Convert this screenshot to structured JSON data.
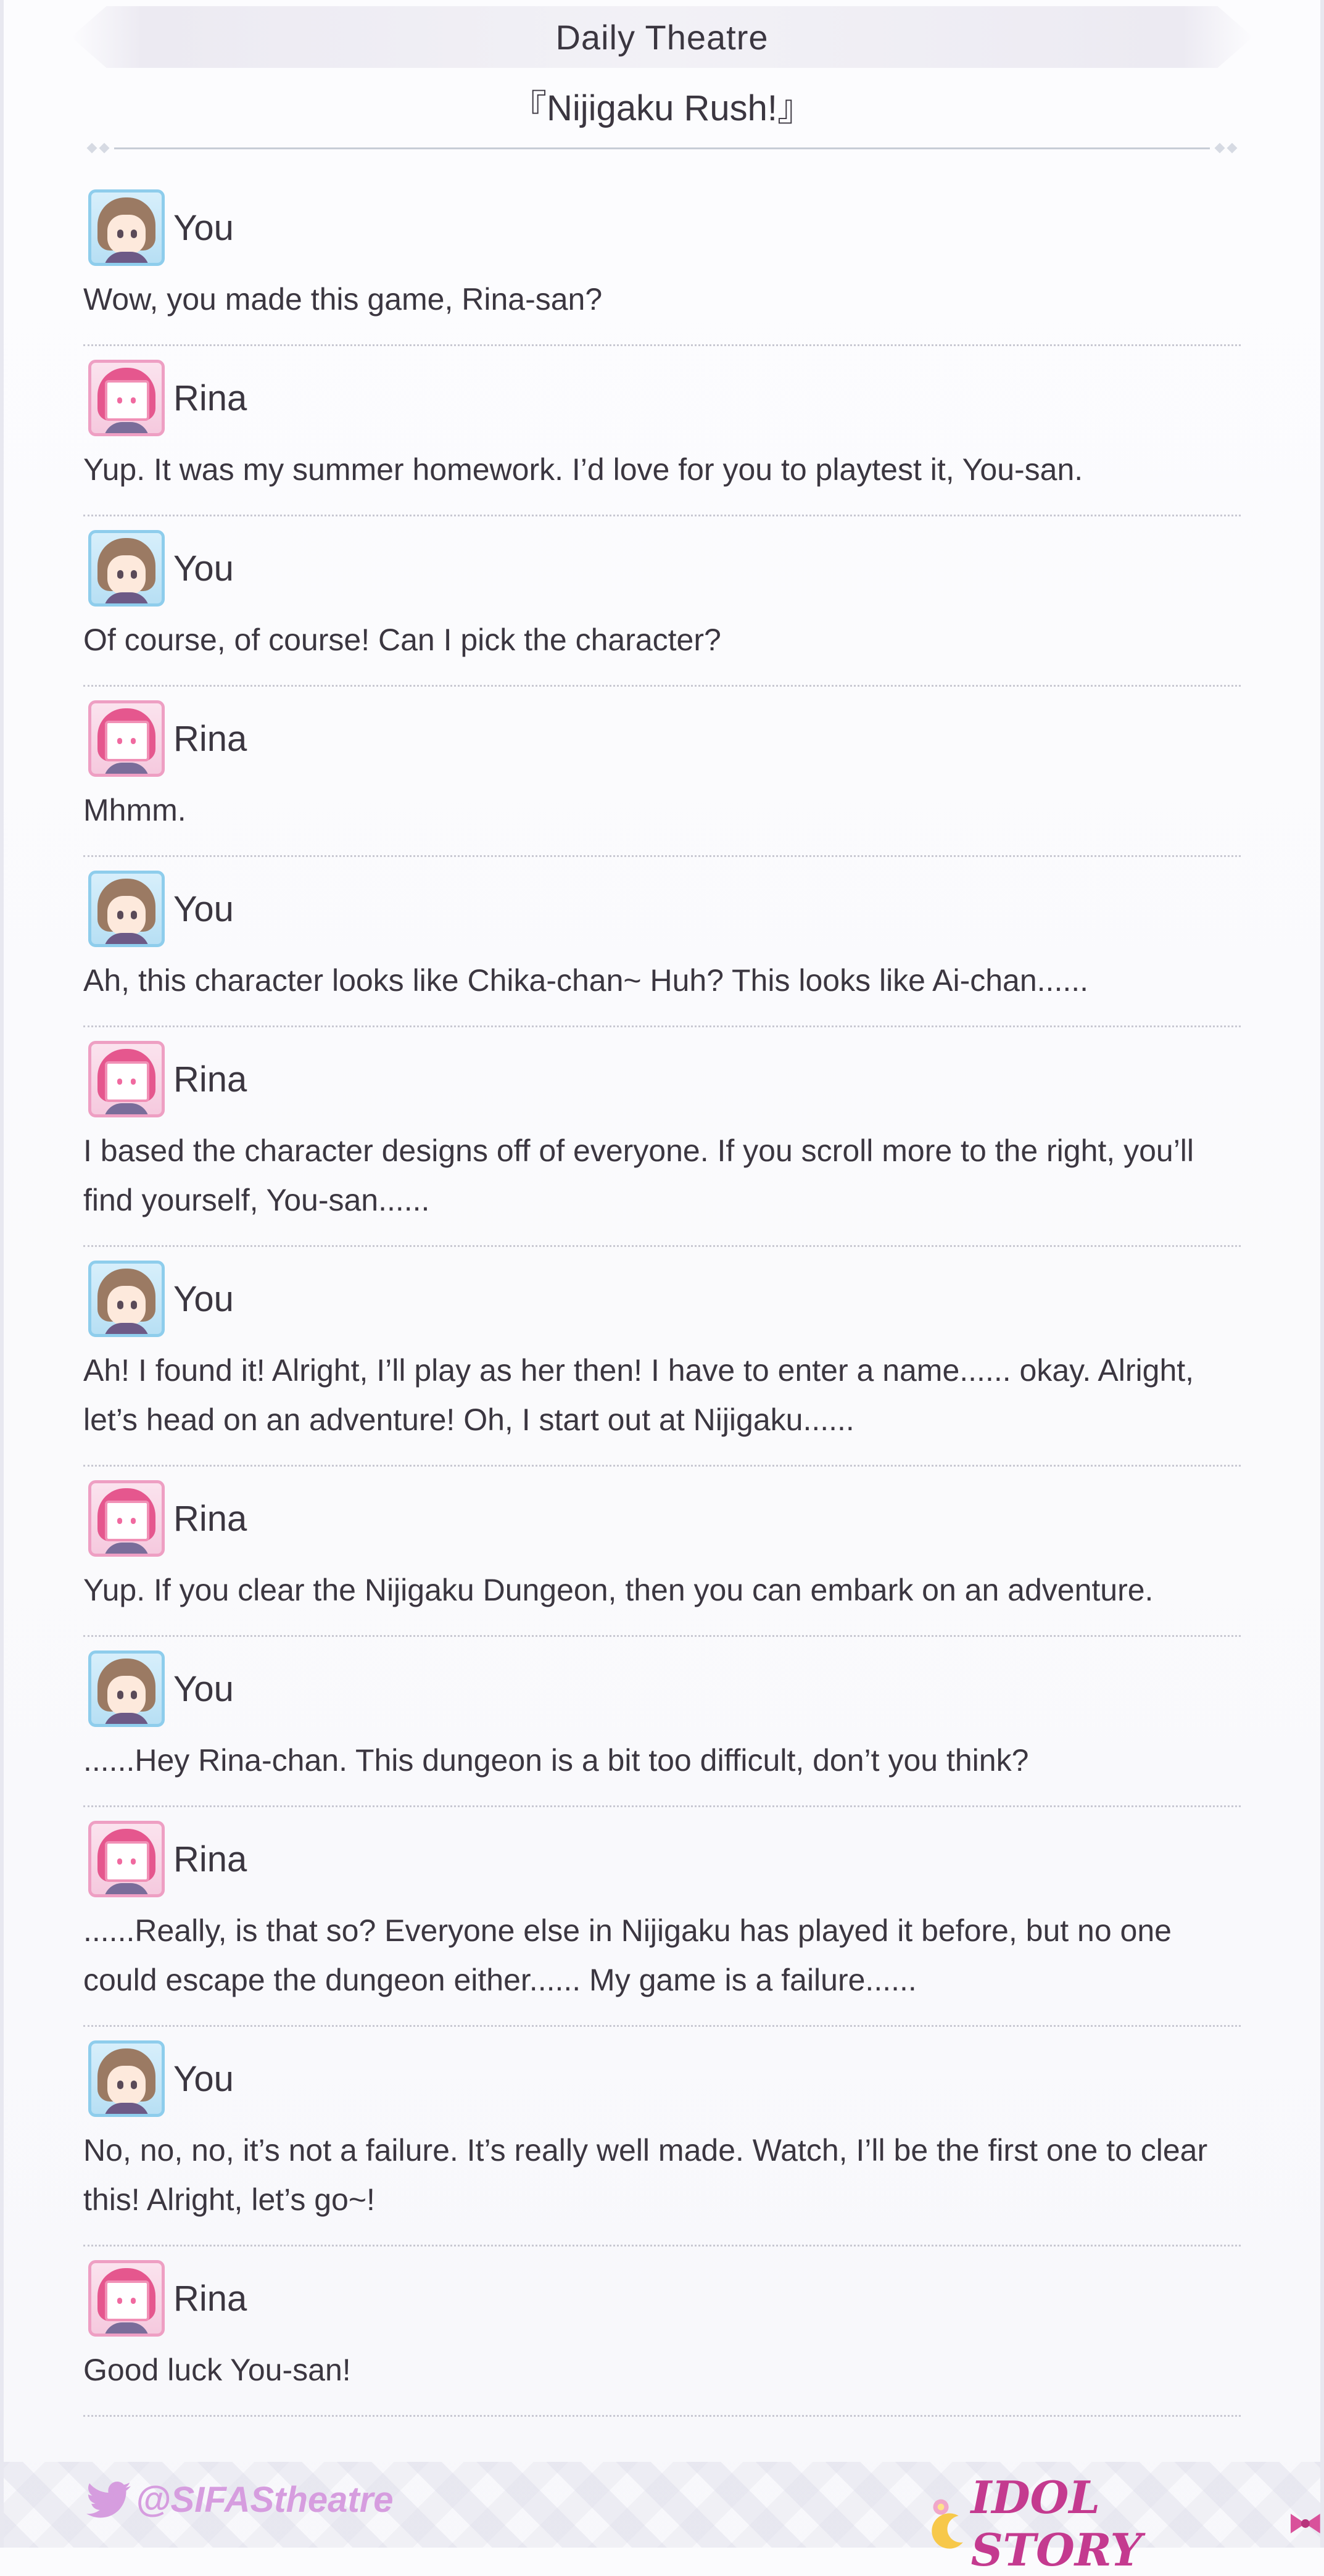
{
  "header": {
    "title": "Daily Theatre",
    "episode": "『Nijigaku Rush!』"
  },
  "dialogue": [
    {
      "speaker": "You",
      "avatar": "you",
      "text": "Wow, you made this game, Rina-san?"
    },
    {
      "speaker": "Rina",
      "avatar": "rina",
      "text": "Yup. It was my summer homework. I’d love for you to playtest it, You-san."
    },
    {
      "speaker": "You",
      "avatar": "you",
      "text": "Of course, of course! Can I pick the character?"
    },
    {
      "speaker": "Rina",
      "avatar": "rina",
      "text": "Mhmm."
    },
    {
      "speaker": "You",
      "avatar": "you",
      "text": "Ah, this character looks like Chika-chan~ Huh? This looks like Ai-chan......"
    },
    {
      "speaker": "Rina",
      "avatar": "rina",
      "text": "I based the character designs off of everyone. If you scroll more to the right, you’ll find yourself, You-san......"
    },
    {
      "speaker": "You",
      "avatar": "you",
      "text": "Ah! I found it! Alright, I’ll play as her then! I have to enter a name...... okay. Alright, let’s head on an adventure! Oh, I start out at Nijigaku......"
    },
    {
      "speaker": "Rina",
      "avatar": "rina",
      "text": "Yup. If you clear the Nijigaku Dungeon, then you can embark on an adventure."
    },
    {
      "speaker": "You",
      "avatar": "you",
      "text": "......Hey Rina-chan. This dungeon is a bit too difficult, don’t you think?"
    },
    {
      "speaker": "Rina",
      "avatar": "rina",
      "text": "......Really, is that so? Everyone else in Nijigaku has played it before, but no one could escape the dungeon either...... My game is a failure......"
    },
    {
      "speaker": "You",
      "avatar": "you",
      "text": "No, no, no, it’s not a failure. It’s really well made. Watch, I’ll be the first one to clear this! Alright, let’s go~!"
    },
    {
      "speaker": "Rina",
      "avatar": "rina",
      "text": "Good luck You-san!"
    }
  ],
  "footer": {
    "twitter_handle": "@SIFAStheatre",
    "brand": "IDOL STORY",
    "brand_color": "#c43a8f",
    "twitter_color": "#d69ddf"
  }
}
